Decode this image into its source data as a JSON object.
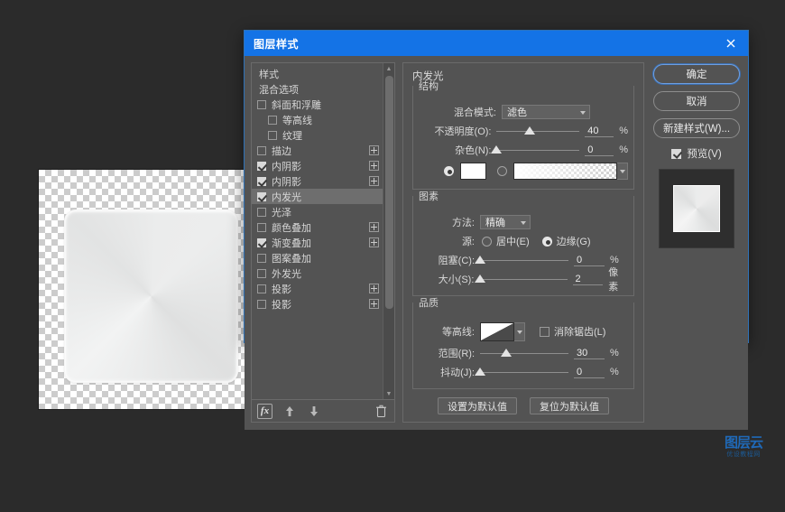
{
  "dialog": {
    "title": "图层样式",
    "close_icon": "close-icon"
  },
  "sidebar": {
    "items": [
      {
        "label": "样式",
        "type": "heading",
        "checked": false,
        "indent": false,
        "plus": false,
        "selected": false
      },
      {
        "label": "混合选项",
        "type": "heading",
        "checked": false,
        "indent": false,
        "plus": false,
        "selected": false
      },
      {
        "label": "斜面和浮雕",
        "type": "effect",
        "checked": false,
        "indent": false,
        "plus": false,
        "selected": false
      },
      {
        "label": "等高线",
        "type": "effect",
        "checked": false,
        "indent": true,
        "plus": false,
        "selected": false
      },
      {
        "label": "纹理",
        "type": "effect",
        "checked": false,
        "indent": true,
        "plus": false,
        "selected": false
      },
      {
        "label": "描边",
        "type": "effect",
        "checked": false,
        "indent": false,
        "plus": true,
        "selected": false
      },
      {
        "label": "内阴影",
        "type": "effect",
        "checked": true,
        "indent": false,
        "plus": true,
        "selected": false
      },
      {
        "label": "内阴影",
        "type": "effect",
        "checked": true,
        "indent": false,
        "plus": true,
        "selected": false
      },
      {
        "label": "内发光",
        "type": "effect",
        "checked": true,
        "indent": false,
        "plus": false,
        "selected": true
      },
      {
        "label": "光泽",
        "type": "effect",
        "checked": false,
        "indent": false,
        "plus": false,
        "selected": false
      },
      {
        "label": "颜色叠加",
        "type": "effect",
        "checked": false,
        "indent": false,
        "plus": true,
        "selected": false
      },
      {
        "label": "渐变叠加",
        "type": "effect",
        "checked": true,
        "indent": false,
        "plus": true,
        "selected": false
      },
      {
        "label": "图案叠加",
        "type": "effect",
        "checked": false,
        "indent": false,
        "plus": false,
        "selected": false
      },
      {
        "label": "外发光",
        "type": "effect",
        "checked": false,
        "indent": false,
        "plus": false,
        "selected": false
      },
      {
        "label": "投影",
        "type": "effect",
        "checked": false,
        "indent": false,
        "plus": true,
        "selected": false
      },
      {
        "label": "投影",
        "type": "effect",
        "checked": false,
        "indent": false,
        "plus": true,
        "selected": false
      }
    ],
    "toolbar": {
      "fx_label": "fx",
      "move_up_icon": "arrow-up-icon",
      "move_down_icon": "arrow-down-icon",
      "delete_icon": "trash-icon"
    },
    "scrollbar": {
      "up_arrow": "▲",
      "down_arrow": "▼"
    }
  },
  "main": {
    "panel_title": "内发光",
    "structure": {
      "legend": "结构",
      "blend_mode_label": "混合模式:",
      "blend_mode_value": "滤色",
      "opacity_label": "不透明度(O):",
      "opacity_value": "40",
      "opacity_unit": "%",
      "noise_label": "杂色(N):",
      "noise_value": "0",
      "noise_unit": "%",
      "fill_type": "color",
      "color_value": "#FFFFFF",
      "gradient_name": "前景色到透明渐变"
    },
    "elements": {
      "legend": "图素",
      "technique_label": "方法:",
      "technique_value": "精确",
      "source_label": "源:",
      "source_center": "居中(E)",
      "source_edge": "边缘(G)",
      "source_selected": "edge",
      "choke_label": "阻塞(C):",
      "choke_value": "0",
      "choke_unit": "%",
      "size_label": "大小(S):",
      "size_value": "2",
      "size_unit": "像素"
    },
    "quality": {
      "legend": "品质",
      "contour_label": "等高线:",
      "antialias_label": "消除锯齿(L)",
      "antialias_checked": false,
      "range_label": "范围(R):",
      "range_value": "30",
      "range_unit": "%",
      "jitter_label": "抖动(J):",
      "jitter_value": "0",
      "jitter_unit": "%"
    },
    "defaults": {
      "make_default": "设置为默认值",
      "reset_default": "复位为默认值"
    }
  },
  "buttons": {
    "ok": "确定",
    "cancel": "取消",
    "new_style": "新建样式(W)...",
    "preview_label": "预览(V)",
    "preview_checked": true
  },
  "watermark": {
    "top": "图层云",
    "bottom": "优设教程网"
  },
  "colors": {
    "title_bar": "#1473E6",
    "panel_bg": "#535353",
    "app_bg": "#2B2B2B",
    "selected_row": "#6E6E6E",
    "accent_border": "#2E72B8"
  }
}
